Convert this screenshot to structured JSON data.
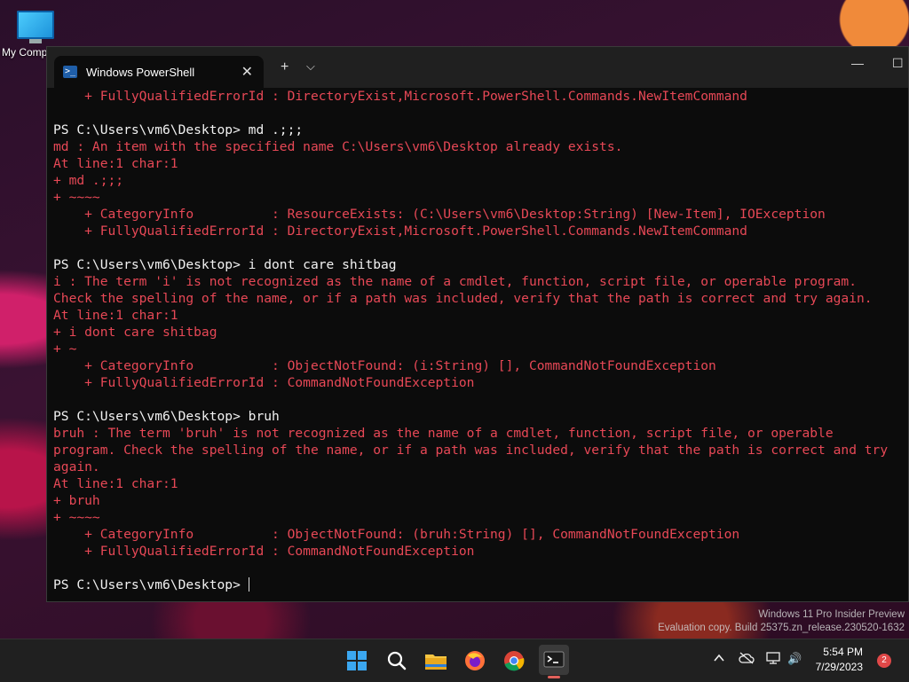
{
  "desktop": {
    "icon_label": "My Comp"
  },
  "window": {
    "tab_title": "Windows PowerShell",
    "tab_icon_glyph": ">_",
    "close_tab": "✕",
    "new_tab": "+",
    "dropdown": "⌵",
    "minimize": "—",
    "maximize": "☐"
  },
  "console": {
    "lines": [
      {
        "cls": "err",
        "text": "    + FullyQualifiedErrorId : DirectoryExist,Microsoft.PowerShell.Commands.NewItemCommand"
      },
      {
        "cls": "",
        "text": ""
      },
      {
        "cls": "cmd",
        "text": "PS C:\\Users\\vm6\\Desktop> md .;;;"
      },
      {
        "cls": "err",
        "text": "md : An item with the specified name C:\\Users\\vm6\\Desktop already exists."
      },
      {
        "cls": "err",
        "text": "At line:1 char:1"
      },
      {
        "cls": "err",
        "text": "+ md .;;;"
      },
      {
        "cls": "err",
        "text": "+ ~~~~"
      },
      {
        "cls": "err",
        "text": "    + CategoryInfo          : ResourceExists: (C:\\Users\\vm6\\Desktop:String) [New-Item], IOException"
      },
      {
        "cls": "err",
        "text": "    + FullyQualifiedErrorId : DirectoryExist,Microsoft.PowerShell.Commands.NewItemCommand"
      },
      {
        "cls": "",
        "text": ""
      },
      {
        "cls": "cmd",
        "text": "PS C:\\Users\\vm6\\Desktop> i dont care shitbag"
      },
      {
        "cls": "err",
        "text": "i : The term 'i' is not recognized as the name of a cmdlet, function, script file, or operable program."
      },
      {
        "cls": "err",
        "text": "Check the spelling of the name, or if a path was included, verify that the path is correct and try again."
      },
      {
        "cls": "err",
        "text": "At line:1 char:1"
      },
      {
        "cls": "err",
        "text": "+ i dont care shitbag"
      },
      {
        "cls": "err",
        "text": "+ ~"
      },
      {
        "cls": "err",
        "text": "    + CategoryInfo          : ObjectNotFound: (i:String) [], CommandNotFoundException"
      },
      {
        "cls": "err",
        "text": "    + FullyQualifiedErrorId : CommandNotFoundException"
      },
      {
        "cls": "",
        "text": ""
      },
      {
        "cls": "cmd",
        "text": "PS C:\\Users\\vm6\\Desktop> bruh"
      },
      {
        "cls": "err",
        "text": "bruh : The term 'bruh' is not recognized as the name of a cmdlet, function, script file, or operable"
      },
      {
        "cls": "err",
        "text": "program. Check the spelling of the name, or if a path was included, verify that the path is correct and try"
      },
      {
        "cls": "err",
        "text": "again."
      },
      {
        "cls": "err",
        "text": "At line:1 char:1"
      },
      {
        "cls": "err",
        "text": "+ bruh"
      },
      {
        "cls": "err",
        "text": "+ ~~~~"
      },
      {
        "cls": "err",
        "text": "    + CategoryInfo          : ObjectNotFound: (bruh:String) [], CommandNotFoundException"
      },
      {
        "cls": "err",
        "text": "    + FullyQualifiedErrorId : CommandNotFoundException"
      },
      {
        "cls": "",
        "text": ""
      },
      {
        "cls": "cmd",
        "text": "PS C:\\Users\\vm6\\Desktop> "
      }
    ]
  },
  "watermark": {
    "line1": "Windows 11 Pro Insider Preview",
    "line2": "Evaluation copy. Build 25375.zn_release.230520-1632"
  },
  "taskbar": {
    "time": "5:54 PM",
    "date": "7/29/2023",
    "notification_count": "2",
    "chevron": "^",
    "volume": "🔊"
  },
  "colors": {
    "error": "#e74856",
    "console_bg": "#0c0c0c",
    "taskbar_bg": "#202020"
  }
}
